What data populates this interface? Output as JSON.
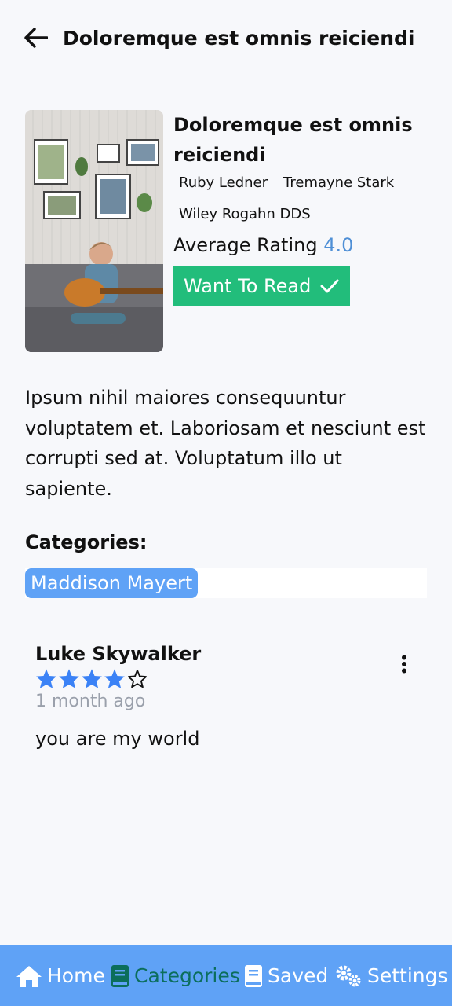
{
  "header": {
    "title": "Doloremque est omnis reiciendi"
  },
  "book": {
    "cover_alt": "Child playing guitar on a sofa",
    "title": "Doloremque est omnis reiciendi",
    "authors": [
      "Ruby Ledner",
      "Tremayne Stark",
      "Wiley Rogahn DDS"
    ],
    "rating_label": "Average Rating",
    "rating_value": "4.0",
    "want_to_read_label": "Want To Read",
    "description": "Ipsum nihil maiores consequuntur voluptatem et. Laboriosam et nesciunt est corrupti sed at. Voluptatum illo ut sapiente."
  },
  "categories": {
    "heading": "Categories:",
    "items": [
      "Maddison Mayert"
    ]
  },
  "reviews": [
    {
      "author": "Luke Skywalker",
      "rating": 4,
      "max_rating": 5,
      "time": "1 month ago",
      "text": "you are my world"
    }
  ],
  "nav": {
    "items": [
      {
        "label": "Home",
        "icon": "home-icon"
      },
      {
        "label": "Categories",
        "icon": "book-icon",
        "active": true
      },
      {
        "label": "Saved",
        "icon": "saved-book-icon"
      },
      {
        "label": "Settings",
        "icon": "gears-icon"
      }
    ]
  },
  "colors": {
    "accent": "#5fa2f6",
    "rating": "#4f8fd6",
    "want_to_read": "#22bd7b",
    "active_nav": "#0b6e5c",
    "star": "#3b82f6"
  }
}
